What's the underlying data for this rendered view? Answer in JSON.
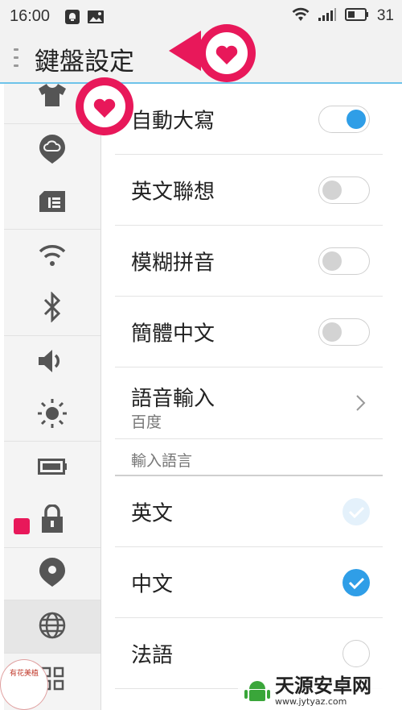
{
  "status_bar": {
    "time": "16:00",
    "left_icons": [
      "notification-icon",
      "image-icon"
    ],
    "right_icons": [
      "wifi-icon",
      "signal-icon",
      "battery-icon"
    ],
    "battery_level": "31"
  },
  "header": {
    "title": "鍵盤設定"
  },
  "sidebar": {
    "items": [
      {
        "icon": "shirt-icon"
      },
      {
        "icon": "cloud-icon"
      },
      {
        "icon": "sim-card-icon"
      },
      {
        "icon": "wifi-icon"
      },
      {
        "icon": "bluetooth-icon"
      },
      {
        "icon": "volume-icon"
      },
      {
        "icon": "brightness-icon"
      },
      {
        "icon": "battery-icon"
      },
      {
        "icon": "lock-icon"
      },
      {
        "icon": "location-icon"
      },
      {
        "icon": "globe-icon",
        "active": true
      },
      {
        "icon": "apps-grid-icon"
      }
    ]
  },
  "settings": {
    "toggles": [
      {
        "label": "自動大寫",
        "on": true
      },
      {
        "label": "英文聯想",
        "on": false
      },
      {
        "label": "模糊拼音",
        "on": false
      },
      {
        "label": "簡體中文",
        "on": false
      }
    ],
    "voice_input": {
      "label": "語音輸入",
      "value": "百度"
    },
    "language_section": {
      "header": "輸入語言",
      "languages": [
        {
          "label": "英文",
          "state": "checked-disabled"
        },
        {
          "label": "中文",
          "state": "checked"
        },
        {
          "label": "法語",
          "state": "unchecked"
        }
      ]
    }
  },
  "watermark": {
    "left_lines": [
      "有花美植"
    ],
    "site_name": "天源安卓网",
    "site_url": "www.jytyaz.com"
  },
  "colors": {
    "accent": "#2f9ee7",
    "callout_pink": "#e8185a",
    "title_underline": "#6ec3ea"
  }
}
